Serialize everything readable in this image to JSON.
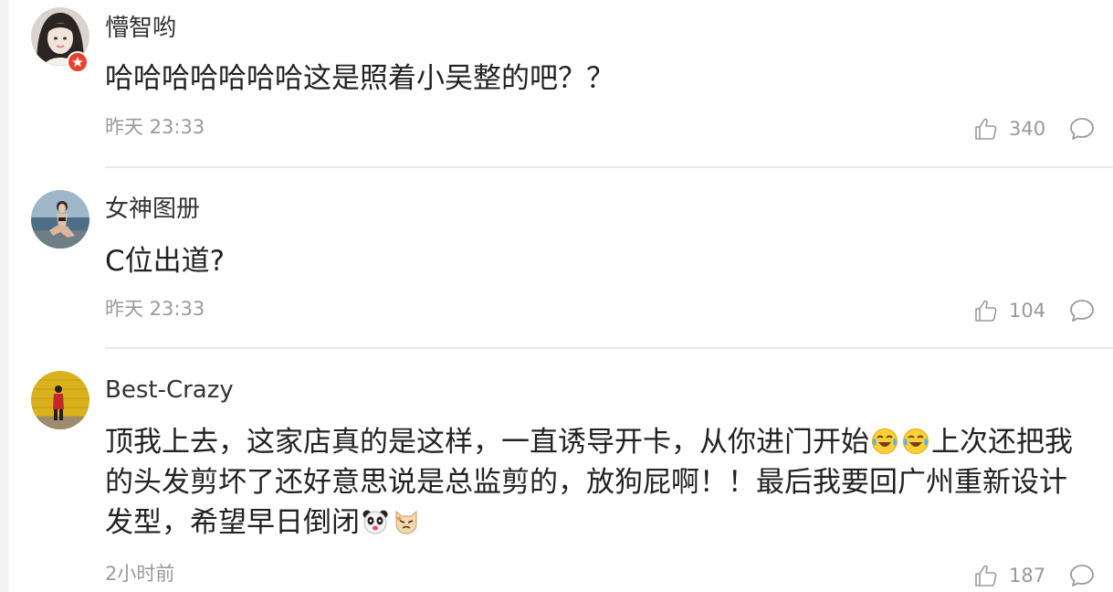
{
  "comments": [
    {
      "username": "懵智哟",
      "content": "哈哈哈哈哈哈哈这是照着小吴整的吧？？",
      "time": "昨天 23:33",
      "likes": "340",
      "verified": true
    },
    {
      "username": "女神图册",
      "content": "C位出道?",
      "time": "昨天 23:33",
      "likes": "104",
      "verified": false
    },
    {
      "username": "Best-Crazy",
      "content_part1": "顶我上去，这家店真的是这样，一直诱导开卡，从你进门开始",
      "content_part2": "上次还把我的头发剪坏了还好意思说是总监剪的，放狗屁啊！！最后我要回广州重新设计发型，希望早日倒闭",
      "time": "2小时前",
      "likes": "187",
      "verified": false,
      "emojis": [
        "laugh-cry-emoji",
        "laugh-cry-emoji",
        "panda-emoji",
        "cat-emoji"
      ]
    }
  ],
  "colors": {
    "username": "#333333",
    "content": "#222222",
    "meta": "#9a9a9a",
    "divider": "#e8e8e8",
    "verified_badge": "#e8412e"
  },
  "icons": [
    "thumbs-up-icon",
    "comment-bubble-icon",
    "verified-badge-icon"
  ]
}
